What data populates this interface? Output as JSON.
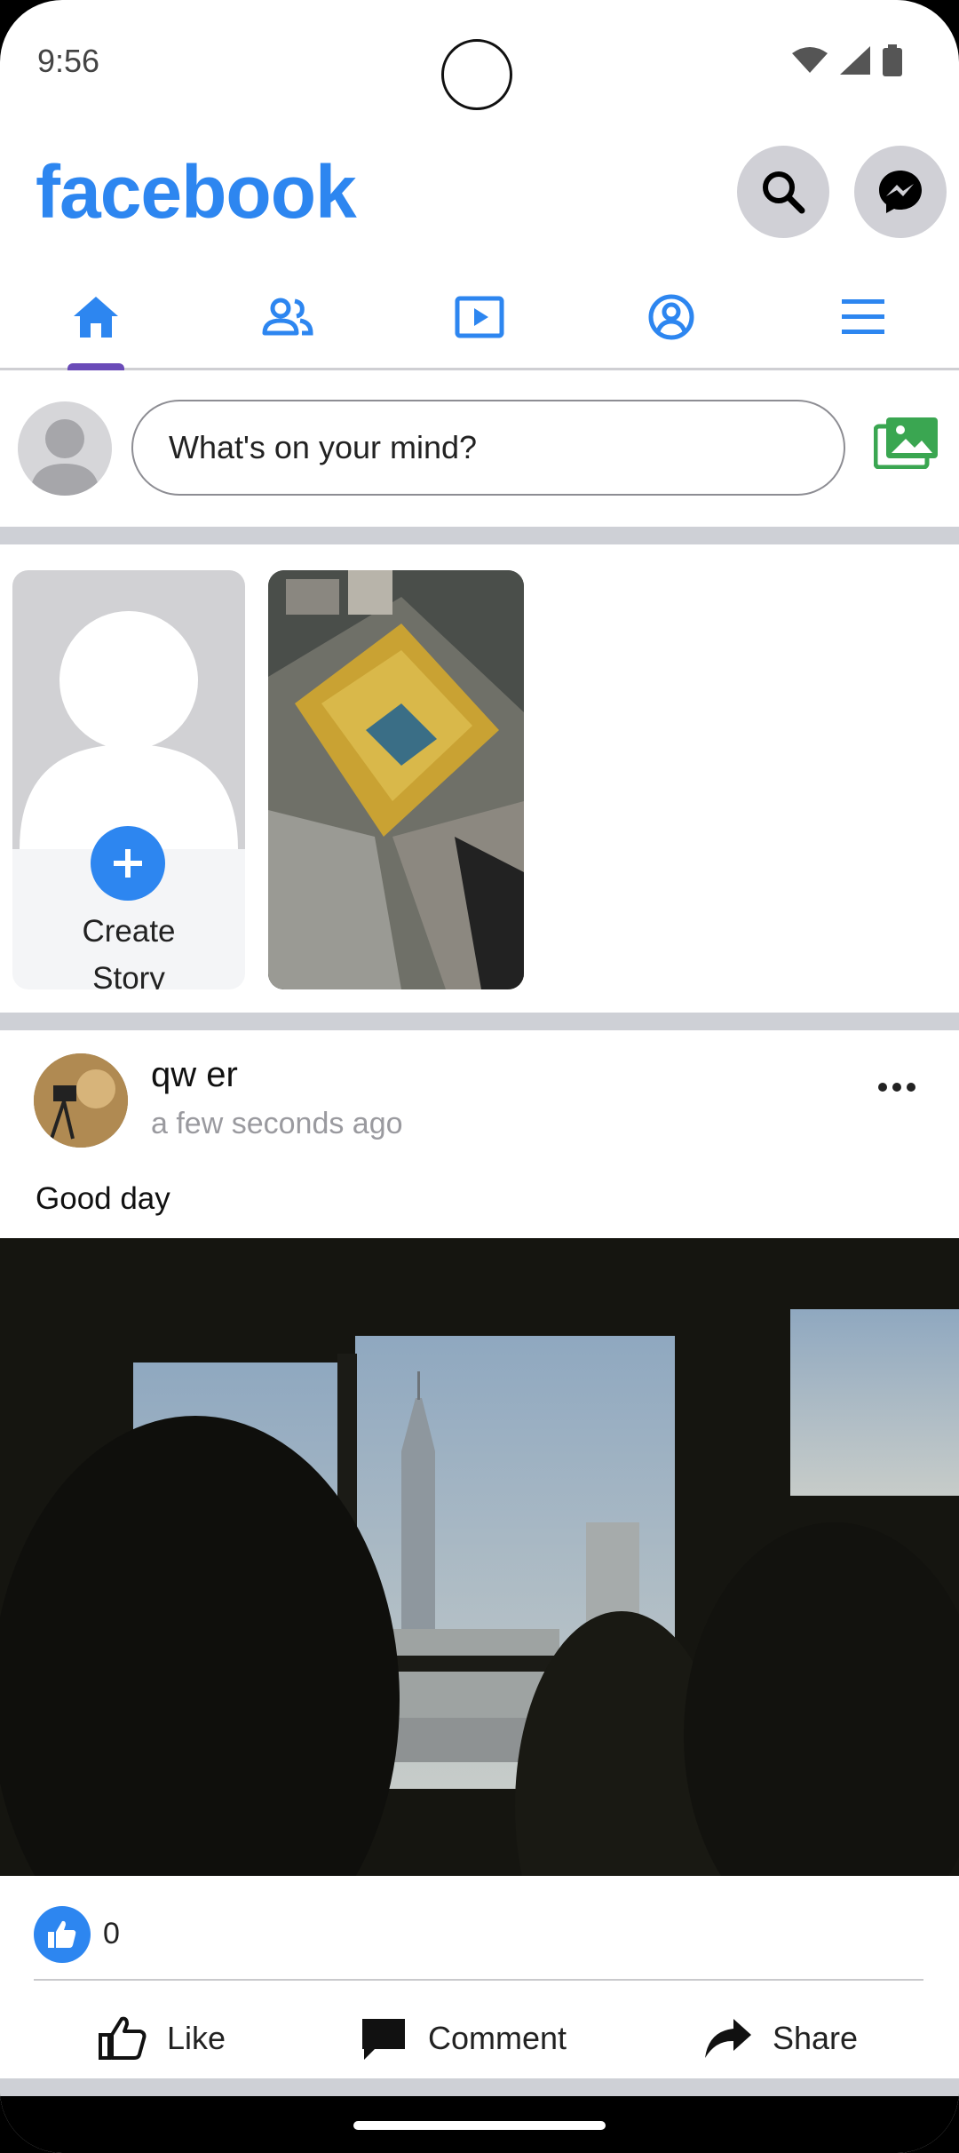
{
  "status_bar": {
    "time": "9:56",
    "icons": [
      "wifi-icon",
      "signal-icon",
      "battery-icon"
    ]
  },
  "header": {
    "logo": "facebook",
    "buttons": [
      "search-icon",
      "messenger-icon"
    ]
  },
  "tabs": [
    {
      "name": "home",
      "icon": "home-icon",
      "selected": true
    },
    {
      "name": "friends",
      "icon": "friends-icon",
      "selected": false
    },
    {
      "name": "watch",
      "icon": "video-icon",
      "selected": false
    },
    {
      "name": "profile",
      "icon": "profile-icon",
      "selected": false
    },
    {
      "name": "menu",
      "icon": "menu-icon",
      "selected": false
    }
  ],
  "composer": {
    "placeholder": "What's on your mind?"
  },
  "stories": {
    "create_label_line1": "Create",
    "create_label_line2": "Story"
  },
  "post": {
    "author": "qw er",
    "time": "a few seconds ago",
    "text": "Good day",
    "like_count": "0",
    "actions": {
      "like": "Like",
      "comment": "Comment",
      "share": "Share"
    }
  },
  "colors": {
    "brand": "#2d86f0",
    "tab_indicator": "#6a4bb8",
    "photo_icon": "#3aa651",
    "divider": "#ced0d6"
  }
}
